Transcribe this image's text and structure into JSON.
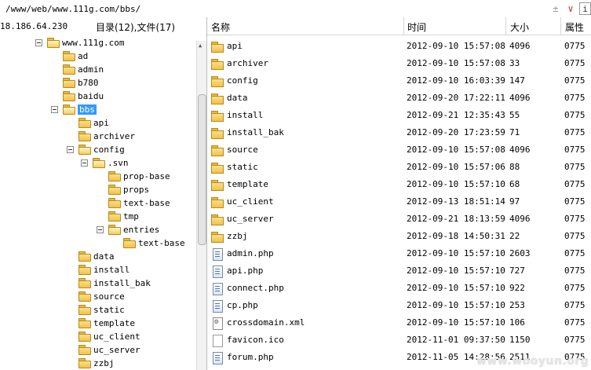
{
  "address": {
    "path": "/www/web/www.111g.com/bbs/",
    "btn_plus": "±",
    "btn_chevron": "∨",
    "btn_last": "i"
  },
  "left_header": {
    "ip": "18.186.64.230",
    "counts": "目录(12),文件(17)"
  },
  "tree": [
    {
      "label": "www.111g.com",
      "depth": 0,
      "expander": "⊟"
    },
    {
      "label": "ad",
      "depth": 1,
      "expander": ""
    },
    {
      "label": "admin",
      "depth": 1,
      "expander": ""
    },
    {
      "label": "b780",
      "depth": 1,
      "expander": ""
    },
    {
      "label": "baidu",
      "depth": 1,
      "expander": ""
    },
    {
      "label": "bbs",
      "depth": 1,
      "expander": "⊟",
      "selected": true
    },
    {
      "label": "api",
      "depth": 2,
      "expander": ""
    },
    {
      "label": "archiver",
      "depth": 2,
      "expander": ""
    },
    {
      "label": "config",
      "depth": 2,
      "expander": "⊟"
    },
    {
      "label": ".svn",
      "depth": 3,
      "expander": "⊟"
    },
    {
      "label": "prop-base",
      "depth": 4,
      "expander": ""
    },
    {
      "label": "props",
      "depth": 4,
      "expander": ""
    },
    {
      "label": "text-base",
      "depth": 4,
      "expander": ""
    },
    {
      "label": "tmp",
      "depth": 4,
      "expander": ""
    },
    {
      "label": "entries",
      "depth": 4,
      "expander": "⊟"
    },
    {
      "label": "text-base",
      "depth": 5,
      "expander": ""
    },
    {
      "label": "data",
      "depth": 2,
      "expander": ""
    },
    {
      "label": "install",
      "depth": 2,
      "expander": ""
    },
    {
      "label": "install_bak",
      "depth": 2,
      "expander": ""
    },
    {
      "label": "source",
      "depth": 2,
      "expander": ""
    },
    {
      "label": "static",
      "depth": 2,
      "expander": ""
    },
    {
      "label": "template",
      "depth": 2,
      "expander": ""
    },
    {
      "label": "uc_client",
      "depth": 2,
      "expander": ""
    },
    {
      "label": "uc_server",
      "depth": 2,
      "expander": ""
    },
    {
      "label": "zzbj",
      "depth": 2,
      "expander": ""
    }
  ],
  "columns": {
    "name": "名称",
    "time": "时间",
    "size": "大小",
    "attr": "属性"
  },
  "files": [
    {
      "name": "api",
      "time": "2012-09-10 15:57:08",
      "size": "4096",
      "attr": "0775",
      "icon": "folder-icon"
    },
    {
      "name": "archiver",
      "time": "2012-09-10 15:57:08",
      "size": "33",
      "attr": "0775",
      "icon": "folder-icon"
    },
    {
      "name": "config",
      "time": "2012-09-10 16:03:39",
      "size": "147",
      "attr": "0775",
      "icon": "folder-icon"
    },
    {
      "name": "data",
      "time": "2012-09-20 17:22:11",
      "size": "4096",
      "attr": "0775",
      "icon": "folder-icon"
    },
    {
      "name": "install",
      "time": "2012-09-21 12:35:43",
      "size": "55",
      "attr": "0775",
      "icon": "folder-icon"
    },
    {
      "name": "install_bak",
      "time": "2012-09-20 17:23:59",
      "size": "71",
      "attr": "0775",
      "icon": "folder-icon"
    },
    {
      "name": "source",
      "time": "2012-09-10 15:57:08",
      "size": "4096",
      "attr": "0775",
      "icon": "folder-icon"
    },
    {
      "name": "static",
      "time": "2012-09-10 15:57:06",
      "size": "88",
      "attr": "0775",
      "icon": "folder-icon"
    },
    {
      "name": "template",
      "time": "2012-09-10 15:57:10",
      "size": "68",
      "attr": "0775",
      "icon": "folder-icon"
    },
    {
      "name": "uc_client",
      "time": "2012-09-13 18:51:14",
      "size": "97",
      "attr": "0775",
      "icon": "folder-icon"
    },
    {
      "name": "uc_server",
      "time": "2012-09-21 18:13:59",
      "size": "4096",
      "attr": "0775",
      "icon": "folder-icon"
    },
    {
      "name": "zzbj",
      "time": "2012-09-18 14:50:31",
      "size": "22",
      "attr": "0775",
      "icon": "folder-icon"
    },
    {
      "name": "admin.php",
      "time": "2012-09-10 15:57:10",
      "size": "2603",
      "attr": "0775",
      "icon": "php-file-icon"
    },
    {
      "name": "api.php",
      "time": "2012-09-10 15:57:10",
      "size": "727",
      "attr": "0775",
      "icon": "php-file-icon"
    },
    {
      "name": "connect.php",
      "time": "2012-09-10 15:57:10",
      "size": "922",
      "attr": "0775",
      "icon": "php-file-icon"
    },
    {
      "name": "cp.php",
      "time": "2012-09-10 15:57:10",
      "size": "253",
      "attr": "0775",
      "icon": "php-file-icon"
    },
    {
      "name": "crossdomain.xml",
      "time": "2012-09-10 15:57:10",
      "size": "106",
      "attr": "0775",
      "icon": "xml-file-icon"
    },
    {
      "name": "favicon.ico",
      "time": "2012-11-01 09:37:50",
      "size": "1150",
      "attr": "0775",
      "icon": "ico-file-icon"
    },
    {
      "name": "forum.php",
      "time": "2012-11-05 14:28:56",
      "size": "2511",
      "attr": "0775",
      "icon": "php-file-icon"
    }
  ],
  "watermark": "www.wooyun.org"
}
